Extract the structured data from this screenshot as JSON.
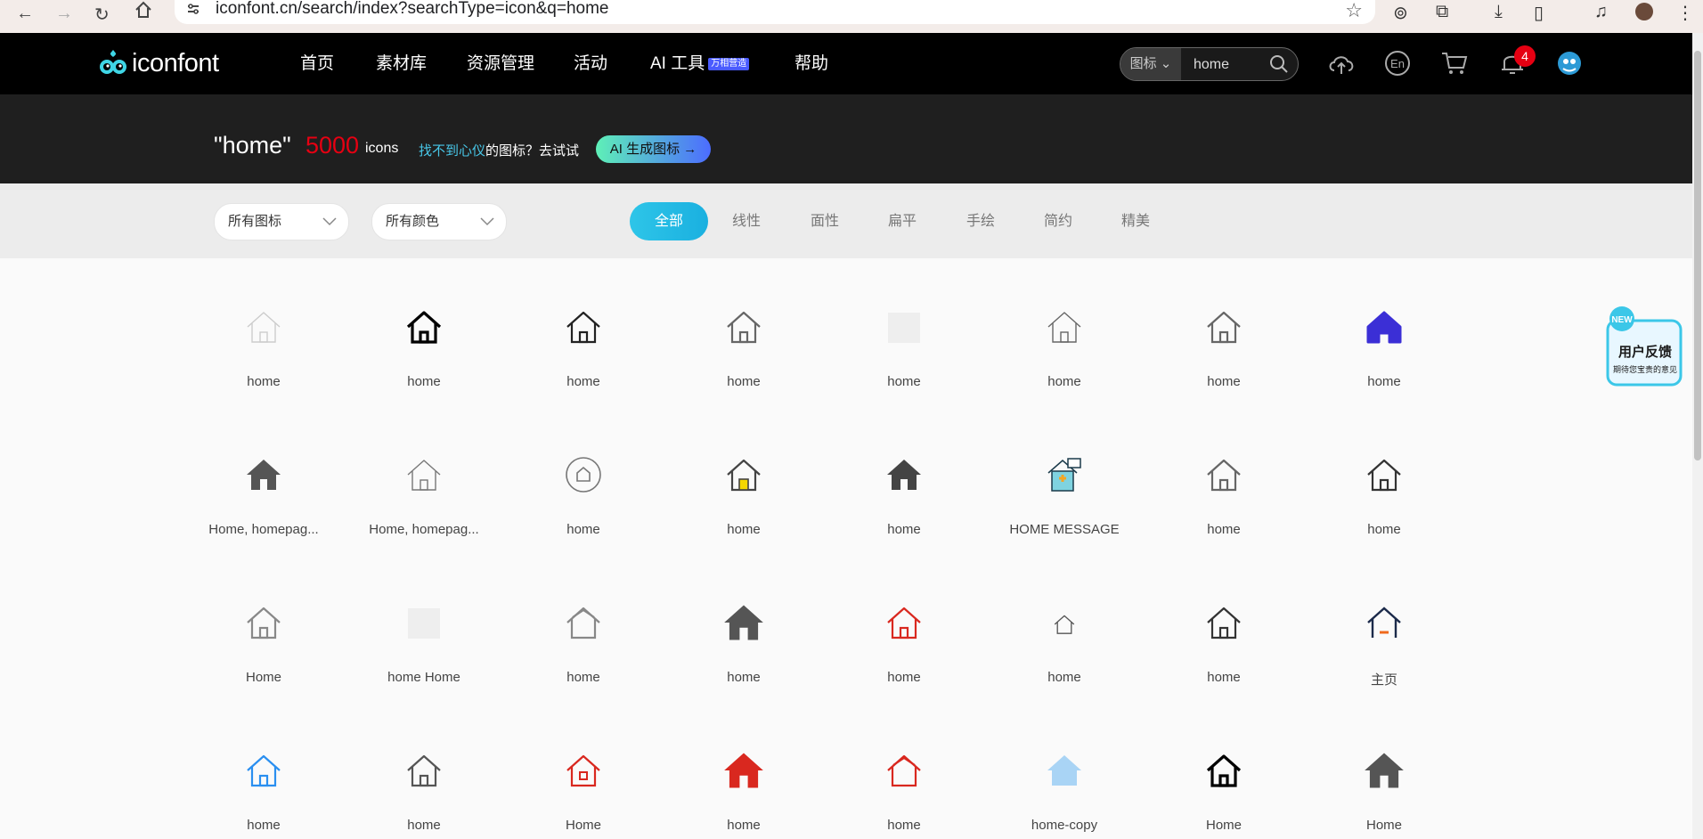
{
  "browser": {
    "url": "iconfont.cn/search/index?searchType=icon&q=home"
  },
  "navbar": {
    "logo_text": "iconfont",
    "menu": [
      {
        "label": "首页"
      },
      {
        "label": "素材库"
      },
      {
        "label": "资源管理"
      },
      {
        "label": "活动"
      },
      {
        "label": "AI 工具"
      },
      {
        "label": "帮助"
      }
    ],
    "ai_badge": "万相营造",
    "search": {
      "type_label": "图标",
      "value": "home"
    },
    "notification_count": "4"
  },
  "banner": {
    "query": "\"home\"",
    "count": "5000",
    "unit": "icons",
    "tip_highlight": "找不到心仪",
    "tip_rest": "的图标？去试试",
    "ai_button": "AI 生成图标 →"
  },
  "filters": {
    "icon_select": "所有图标",
    "color_select": "所有颜色",
    "tabs": [
      "全部",
      "线性",
      "面性",
      "扁平",
      "手绘",
      "简约",
      "精美"
    ],
    "active_tab": "全部"
  },
  "icons": [
    {
      "name": "home",
      "color": "#cccccc",
      "style": "outline-thin"
    },
    {
      "name": "home",
      "color": "#000000",
      "style": "outline-bold"
    },
    {
      "name": "home",
      "color": "#222222",
      "style": "outline-tall"
    },
    {
      "name": "home",
      "color": "#666666",
      "style": "outline"
    },
    {
      "name": "home",
      "color": "#eeeeee",
      "style": "placeholder"
    },
    {
      "name": "home",
      "color": "#666666",
      "style": "outline-thin"
    },
    {
      "name": "home",
      "color": "#666666",
      "style": "outline"
    },
    {
      "name": "home",
      "color": "#3b2fd6",
      "style": "filled-round"
    },
    {
      "name": "Home, homepag...",
      "color": "#555555",
      "style": "filled"
    },
    {
      "name": "Home, homepag...",
      "color": "#777777",
      "style": "outline-thin"
    },
    {
      "name": "home",
      "color": "#777777",
      "style": "circle"
    },
    {
      "name": "home",
      "color": "#444444",
      "style": "outline-yellow"
    },
    {
      "name": "home",
      "color": "#444444",
      "style": "filled"
    },
    {
      "name": "HOME MESSAGE",
      "color": "#39b7c9",
      "style": "colorful"
    },
    {
      "name": "home",
      "color": "#666666",
      "style": "outline"
    },
    {
      "name": "home",
      "color": "#333333",
      "style": "outline-round"
    },
    {
      "name": "Home",
      "color": "#888888",
      "style": "outline-arch"
    },
    {
      "name": "home Home",
      "color": "#eeeeee",
      "style": "placeholder"
    },
    {
      "name": "home",
      "color": "#888888",
      "style": "outline-double"
    },
    {
      "name": "home",
      "color": "#555555",
      "style": "filled-big"
    },
    {
      "name": "home",
      "color": "#d9281f",
      "style": "outline-tall"
    },
    {
      "name": "home",
      "color": "#555555",
      "style": "outline-small"
    },
    {
      "name": "home",
      "color": "#333333",
      "style": "outline-tall"
    },
    {
      "name": "主页",
      "color": "#1b2a4a",
      "style": "outline-orange"
    },
    {
      "name": "home",
      "color": "#2a8ff0",
      "style": "outline-tall"
    },
    {
      "name": "home",
      "color": "#555555",
      "style": "outline-door"
    },
    {
      "name": "Home",
      "color": "#d9281f",
      "style": "outline-window"
    },
    {
      "name": "home",
      "color": "#d9281f",
      "style": "filled-big"
    },
    {
      "name": "home",
      "color": "#d9281f",
      "style": "outline-double"
    },
    {
      "name": "home-copy",
      "color": "#a9d4f5",
      "style": "filled-light"
    },
    {
      "name": "Home",
      "color": "#000000",
      "style": "outline-bold"
    },
    {
      "name": "Home",
      "color": "#555555",
      "style": "filled-big"
    }
  ],
  "feedback": {
    "new_label": "NEW",
    "title": "用户反馈",
    "subtitle": "期待您宝贵的意见"
  }
}
